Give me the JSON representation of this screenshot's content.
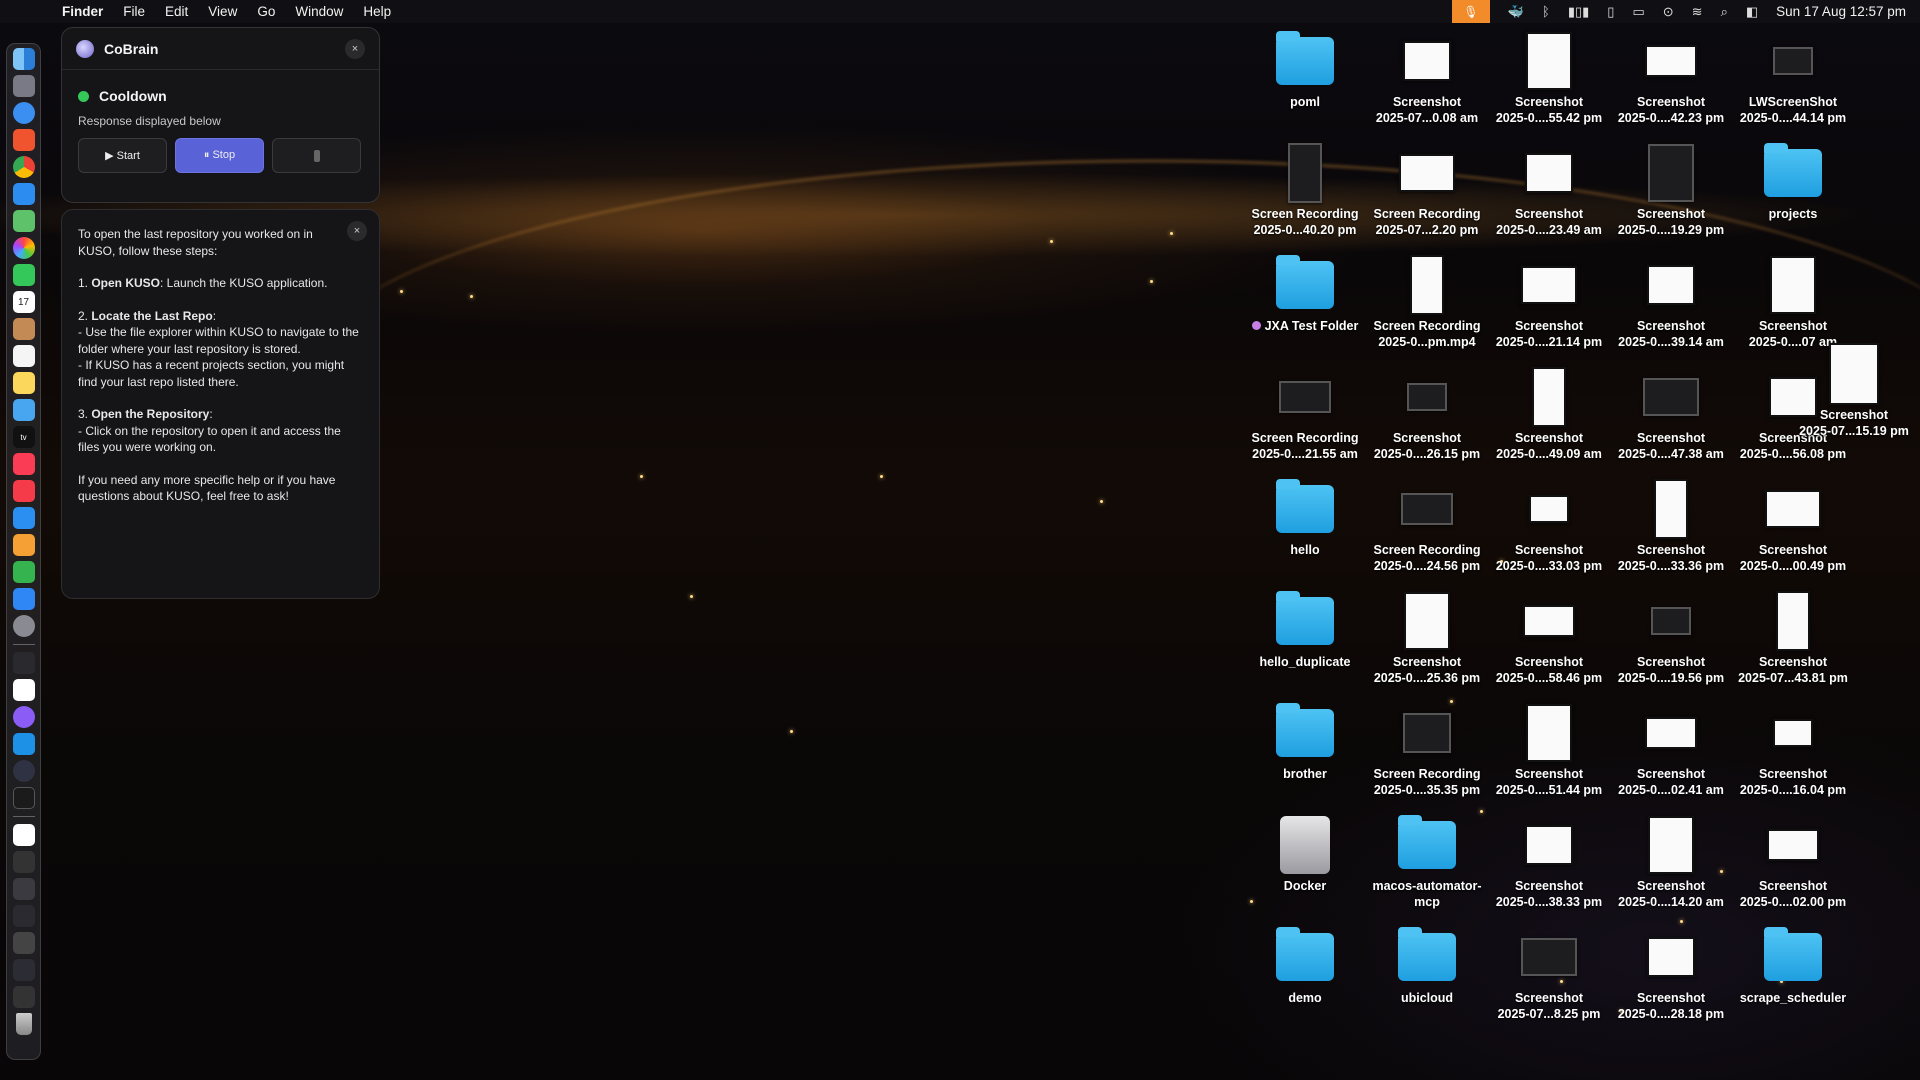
{
  "menubar": {
    "apple": "",
    "app": "Finder",
    "items": [
      "File",
      "Edit",
      "View",
      "Go",
      "Window",
      "Help"
    ],
    "clock": "Sun 17 Aug  12:57 pm"
  },
  "cobrain": {
    "title": "CoBrain",
    "close": "×",
    "status": "Cooldown",
    "subtitle": "Response displayed below",
    "start_label": "▶ Start",
    "stop_label": "⏸ Stop",
    "status_color": "#34c759"
  },
  "response": {
    "close": "×",
    "intro": "To open the last repository you worked on in KUSO, follow these steps:",
    "step1_num": "1. ",
    "step1_title": "Open KUSO",
    "step1_body": ": Launch the KUSO application.",
    "step2_num": "2. ",
    "step2_title": "Locate the Last Repo",
    "step2_body": ":",
    "step2_a": "   - Use the file explorer within KUSO to navigate to the folder where your last repository is stored.",
    "step2_b": "   - If KUSO has a recent projects section, you might find your last repo listed there.",
    "step3_num": "3. ",
    "step3_title": "Open the Repository",
    "step3_body": ":",
    "step3_a": "   - Click on the repository to open it and access the files you were working on.",
    "outro": "If you need any more specific help or if you have questions about KUSO, feel free to ask!"
  },
  "desktop": [
    {
      "type": "folder",
      "l1": "poml",
      "l2": ""
    },
    {
      "type": "thumb",
      "l1": "Screenshot",
      "l2": "2025-07...0.08 am"
    },
    {
      "type": "thumb",
      "l1": "Screenshot",
      "l2": "2025-0....55.42 pm"
    },
    {
      "type": "thumb",
      "l1": "Screenshot",
      "l2": "2025-0....42.23 pm"
    },
    {
      "type": "thumb-dark",
      "l1": "LWScreenShot",
      "l2": "2025-0....44.14 pm"
    },
    {
      "type": "thumb-dark",
      "l1": "Screen Recording",
      "l2": "2025-0...40.20 pm"
    },
    {
      "type": "thumb",
      "l1": "Screen Recording",
      "l2": "2025-07...2.20 pm"
    },
    {
      "type": "thumb",
      "l1": "Screenshot",
      "l2": "2025-0....23.49 am"
    },
    {
      "type": "thumb-dark",
      "l1": "Screenshot",
      "l2": "2025-0....19.29 pm"
    },
    {
      "type": "folder",
      "l1": "projects",
      "l2": ""
    },
    {
      "type": "folder",
      "l1": "JXA Test Folder",
      "l2": "",
      "tag": true
    },
    {
      "type": "thumb",
      "l1": "Screen Recording",
      "l2": "2025-0...pm.mp4"
    },
    {
      "type": "thumb",
      "l1": "Screenshot",
      "l2": "2025-0....21.14 pm"
    },
    {
      "type": "thumb",
      "l1": "Screenshot",
      "l2": "2025-0....39.14 am"
    },
    {
      "type": "thumb",
      "l1": "Screenshot",
      "l2": "2025-0....07 am"
    },
    {
      "type": "thumb-dark",
      "l1": "Screen Recording",
      "l2": "2025-0....21.55 am"
    },
    {
      "type": "thumb-dark",
      "l1": "Screenshot",
      "l2": "2025-0....26.15 pm"
    },
    {
      "type": "thumb",
      "l1": "Screenshot",
      "l2": "2025-0....49.09 am"
    },
    {
      "type": "thumb-dark",
      "l1": "Screenshot",
      "l2": "2025-0....47.38 am"
    },
    {
      "type": "thumb",
      "l1": "Screenshot",
      "l2": "2025-0....56.08 pm"
    },
    {
      "type": "folder",
      "l1": "hello",
      "l2": ""
    },
    {
      "type": "thumb-dark",
      "l1": "Screen Recording",
      "l2": "2025-0....24.56 pm"
    },
    {
      "type": "thumb",
      "l1": "Screenshot",
      "l2": "2025-0....33.03 pm"
    },
    {
      "type": "thumb",
      "l1": "Screenshot",
      "l2": "2025-0....33.36 pm"
    },
    {
      "type": "thumb",
      "l1": "Screenshot",
      "l2": "2025-0....00.49 pm"
    },
    {
      "type": "folder",
      "l1": "hello_duplicate",
      "l2": ""
    },
    {
      "type": "thumb",
      "l1": "Screenshot",
      "l2": "2025-0....25.36 pm"
    },
    {
      "type": "thumb",
      "l1": "Screenshot",
      "l2": "2025-0....58.46 pm"
    },
    {
      "type": "thumb-dark",
      "l1": "Screenshot",
      "l2": "2025-0....19.56 pm"
    },
    {
      "type": "thumb",
      "l1": "Screenshot",
      "l2": "2025-07...43.81 pm"
    },
    {
      "type": "folder",
      "l1": "brother",
      "l2": ""
    },
    {
      "type": "thumb-dark",
      "l1": "Screen Recording",
      "l2": "2025-0....35.35 pm"
    },
    {
      "type": "thumb",
      "l1": "Screenshot",
      "l2": "2025-0....51.44 pm"
    },
    {
      "type": "thumb",
      "l1": "Screenshot",
      "l2": "2025-0....02.41 am"
    },
    {
      "type": "thumb",
      "l1": "Screenshot",
      "l2": "2025-0....16.04 pm"
    },
    {
      "type": "drive",
      "l1": "Docker",
      "l2": ""
    },
    {
      "type": "folder",
      "l1": "macos-automator-",
      "l2": "mcp"
    },
    {
      "type": "thumb",
      "l1": "Screenshot",
      "l2": "2025-0....38.33 pm"
    },
    {
      "type": "thumb",
      "l1": "Screenshot",
      "l2": "2025-0....14.20 am"
    },
    {
      "type": "thumb",
      "l1": "Screenshot",
      "l2": "2025-0....02.00 pm"
    },
    {
      "type": "folder",
      "l1": "demo",
      "l2": ""
    },
    {
      "type": "folder",
      "l1": "ubicloud",
      "l2": ""
    },
    {
      "type": "thumb-dark",
      "l1": "Screenshot",
      "l2": "2025-07...8.25 pm"
    },
    {
      "type": "thumb",
      "l1": "Screenshot",
      "l2": "2025-0....28.18 pm"
    },
    {
      "type": "folder",
      "l1": "scrape_scheduler",
      "l2": ""
    }
  ],
  "extra_item": {
    "l1": "Screenshot",
    "l2": "2025-07...15.19 pm"
  }
}
